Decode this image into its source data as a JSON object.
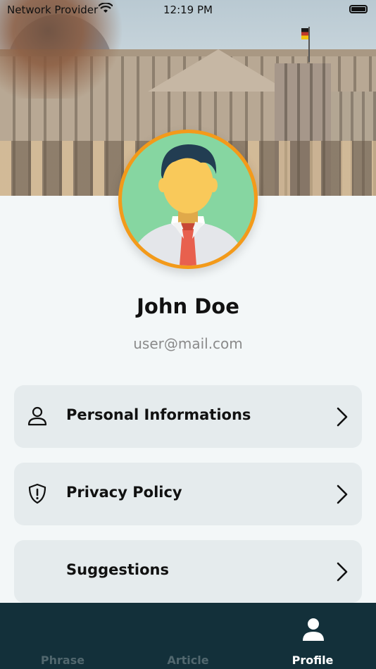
{
  "status_bar": {
    "carrier": "Network Provider",
    "time": "12:19 PM"
  },
  "profile": {
    "name": "John Doe",
    "email": "user@mail.com"
  },
  "menu": [
    {
      "label": "Personal Informations",
      "icon": "person-icon"
    },
    {
      "label": "Privacy Policy",
      "icon": "shield-alert-icon"
    },
    {
      "label": "Suggestions",
      "icon": ""
    }
  ],
  "tabs": [
    {
      "label": "Phrase",
      "active": false
    },
    {
      "label": "Article",
      "active": false
    },
    {
      "label": "Profile",
      "active": true,
      "icon": "user-icon"
    }
  ],
  "colors": {
    "accent": "#f39a1a",
    "tabbar": "#13303a",
    "card": "#e5ebed",
    "background": "#f3f7f8"
  }
}
